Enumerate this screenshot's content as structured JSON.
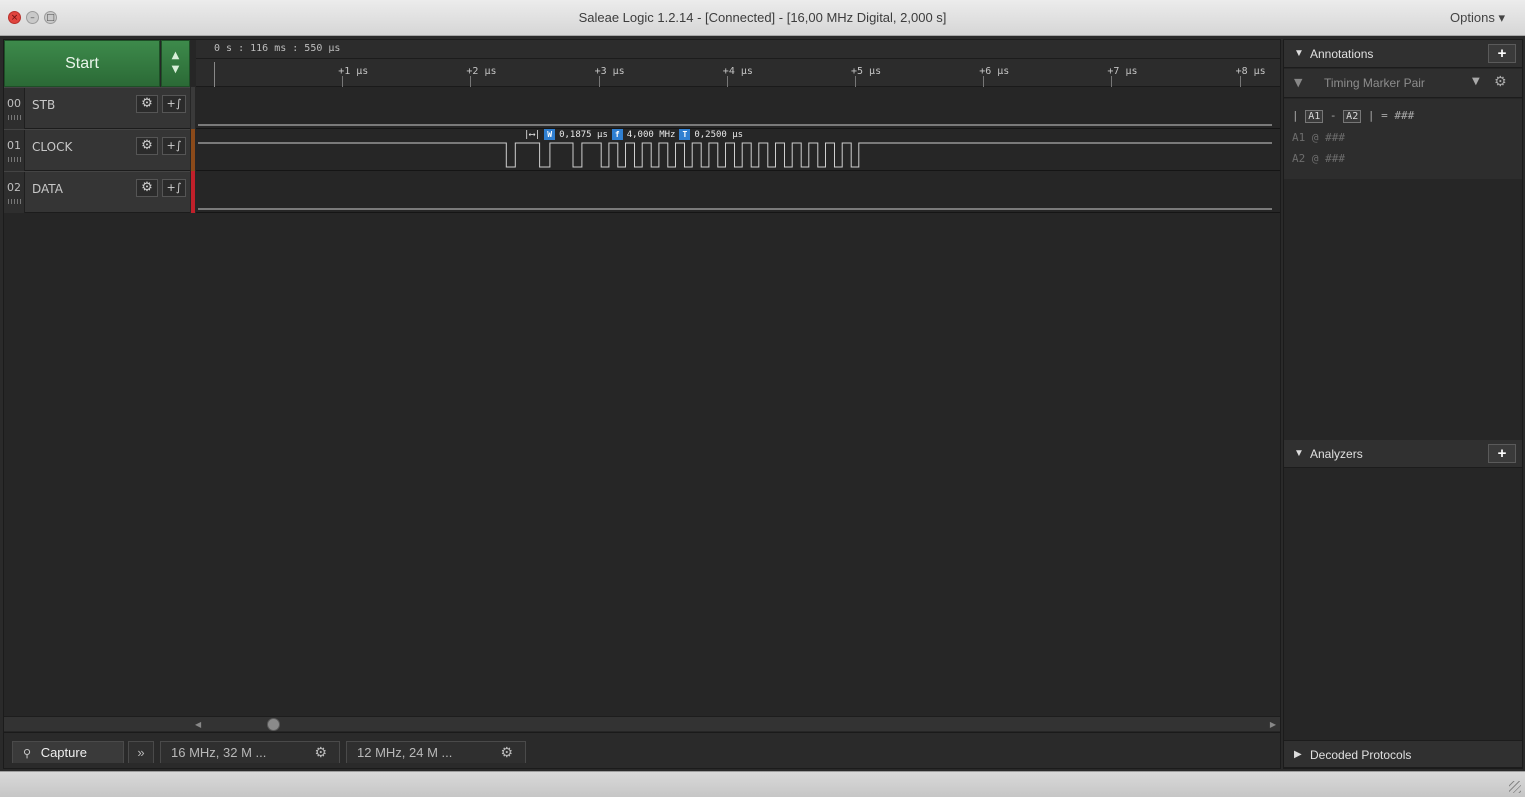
{
  "window": {
    "title": "Saleae Logic 1.2.14 - [Connected] - [16,00 MHz Digital, 2,000 s]",
    "options_label": "Options ▾",
    "close_glyph": "×",
    "min_glyph": "–",
    "max_glyph": "□"
  },
  "toolbar": {
    "start_label": "Start",
    "up_glyph": "▲",
    "down_glyph": "▼"
  },
  "channels": [
    {
      "index": "00",
      "name": "STB",
      "color": "#3a3a3a"
    },
    {
      "index": "01",
      "name": "CLOCK",
      "color": "#8b4a1a"
    },
    {
      "index": "02",
      "name": "DATA",
      "color": "#c0202a"
    }
  ],
  "channel_controls": {
    "gear_glyph": "⚙",
    "trigger_glyph": "+∫"
  },
  "timeline": {
    "origin": "0 s : 116 ms : 550 µs",
    "ticks": [
      "+1 µs",
      "+2 µs",
      "+3 µs",
      "+4 µs",
      "+5 µs",
      "+6 µs",
      "+7 µs",
      "+8 µs"
    ]
  },
  "measurement": {
    "width_badge": "W",
    "width_value": "0,1875 µs",
    "freq_badge": "f",
    "freq_value": "4,000 MHz",
    "period_badge": "T",
    "period_value": "0,2500 µs",
    "arrow": "|⟷|"
  },
  "clock_signal": {
    "transitions_us": [
      2.28,
      2.35,
      2.54,
      2.62,
      2.8,
      2.87,
      3.02,
      3.08,
      3.15,
      3.21,
      3.28,
      3.34,
      3.41,
      3.47,
      3.54,
      3.6,
      3.67,
      3.73,
      3.8,
      3.86,
      3.93,
      3.99,
      4.06,
      4.12,
      4.19,
      4.25,
      4.32,
      4.38,
      4.45,
      4.51,
      4.58,
      4.64,
      4.71,
      4.77,
      4.84,
      4.9,
      4.97,
      5.03
    ]
  },
  "bottom_tabs": {
    "capture_label": "Capture",
    "capture_icon": "🔍",
    "more_glyph": "»",
    "tab1_label": "16 MHz, 32 M ...",
    "tab2_label": "12 MHz, 24 M ..."
  },
  "scrollbar": {
    "left_glyph": "◀",
    "right_glyph": "▶"
  },
  "annotations": {
    "header": "Annotations",
    "plus": "+",
    "marker_type": "Timing Marker Pair",
    "formula_pipe_open": "|",
    "a1": "A1",
    "minus": "-",
    "a2": "A2",
    "formula_tail": "| = ###",
    "row_a1": "A1  @  ###",
    "row_a2": "A2  @  ###"
  },
  "analyzers": {
    "header": "Analyzers",
    "plus": "+"
  },
  "decoded": {
    "header": "Decoded Protocols"
  }
}
